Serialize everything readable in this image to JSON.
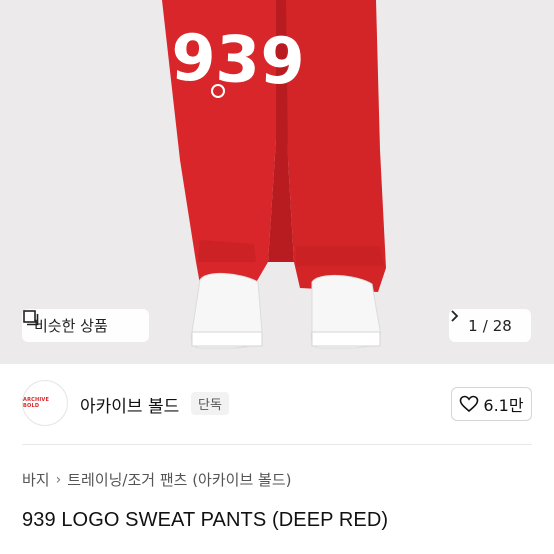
{
  "hero": {
    "print_text": "939",
    "similar_button_label": "비슷한 상품",
    "current_page": "1",
    "page_separator": "/",
    "total_pages": "28",
    "product_color": "#d8262a"
  },
  "shop": {
    "logo_text": "ARCHIVE BOLD",
    "name": "아카이브 볼드",
    "badge": "단독",
    "like_count": "6.1만"
  },
  "breadcrumb": {
    "level1": "바지",
    "level2": "트레이닝/조거 팬츠 (아카이브 볼드)"
  },
  "product": {
    "title": "939 LOGO SWEAT PANTS (DEEP RED)"
  }
}
